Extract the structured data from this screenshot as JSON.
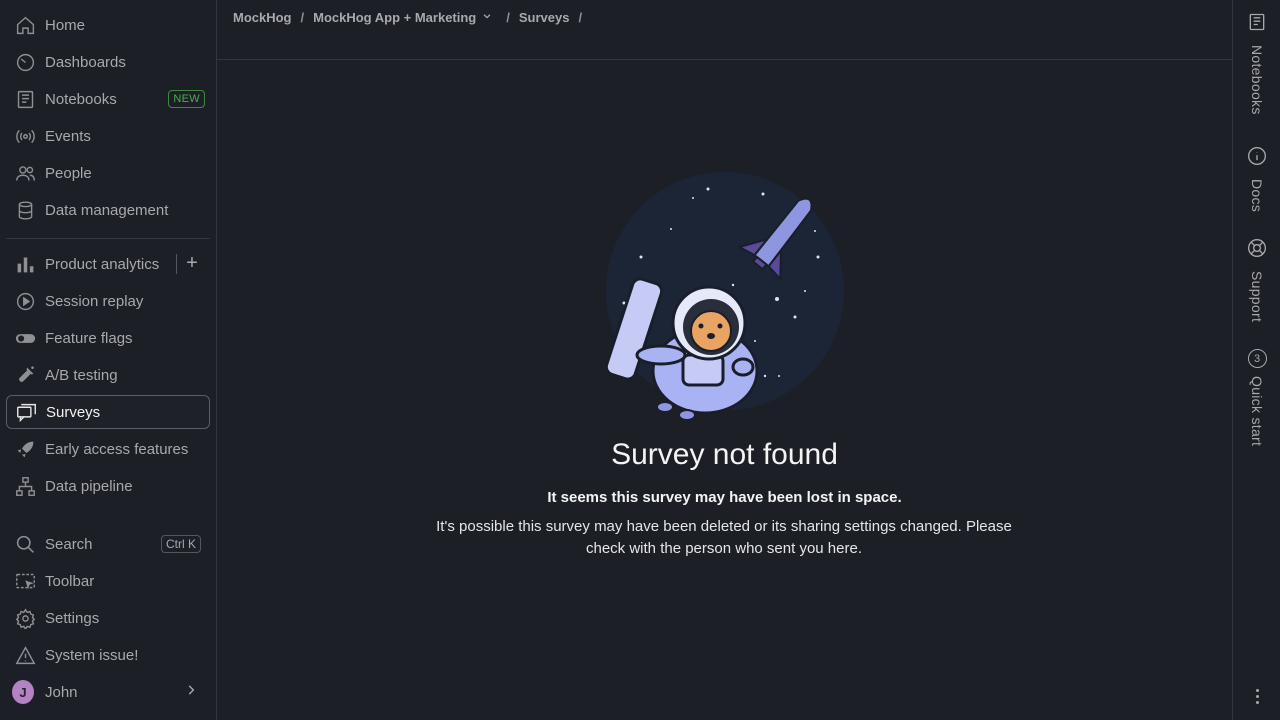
{
  "sidebar": {
    "items": [
      {
        "label": "Home",
        "icon": "home-icon"
      },
      {
        "label": "Dashboards",
        "icon": "gauge-icon"
      },
      {
        "label": "Notebooks",
        "icon": "notebook-icon",
        "badge": "NEW"
      },
      {
        "label": "Events",
        "icon": "broadcast-icon"
      },
      {
        "label": "People",
        "icon": "people-icon"
      },
      {
        "label": "Data management",
        "icon": "database-icon"
      },
      {
        "label": "Product analytics",
        "icon": "bar-chart-icon"
      },
      {
        "label": "Session replay",
        "icon": "play-circle-icon"
      },
      {
        "label": "Feature flags",
        "icon": "toggle-icon"
      },
      {
        "label": "A/B testing",
        "icon": "flask-icon"
      },
      {
        "label": "Surveys",
        "icon": "chat-icon",
        "active": true
      },
      {
        "label": "Early access features",
        "icon": "rocket-icon"
      },
      {
        "label": "Data pipeline",
        "icon": "pipeline-icon"
      },
      {
        "label": "Search",
        "icon": "search-icon",
        "shortcut": "Ctrl K"
      },
      {
        "label": "Toolbar",
        "icon": "toolbar-icon"
      },
      {
        "label": "Settings",
        "icon": "gear-icon"
      },
      {
        "label": "System issue!",
        "icon": "warning-icon"
      }
    ],
    "user": {
      "name": "John",
      "initial": "J"
    },
    "add_symbol": "+"
  },
  "breadcrumb": {
    "org": "MockHog",
    "project": "MockHog App + Marketing",
    "page": "Surveys",
    "separator": "/"
  },
  "main": {
    "title": "Survey not found",
    "subtitle": "It seems this survey may have been lost in space.",
    "description": "It's possible this survey may have been deleted or its sharing settings changed. Please check with the person who sent you here."
  },
  "rightbar": {
    "items": [
      {
        "label": "Notebooks",
        "icon": "notebook-icon"
      },
      {
        "label": "Docs",
        "icon": "info-icon"
      },
      {
        "label": "Support",
        "icon": "lifebuoy-icon"
      },
      {
        "label": "Quick start",
        "count": "3"
      }
    ]
  },
  "colors": {
    "background": "#1d1f27",
    "border": "#34363f",
    "new_badge": "#4cae4f",
    "avatar": "#b383c3"
  }
}
